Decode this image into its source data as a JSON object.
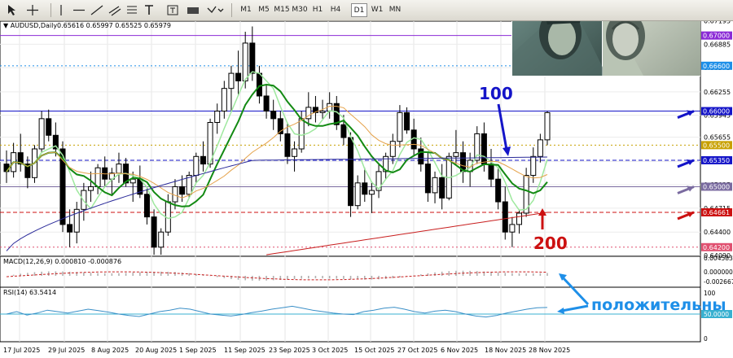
{
  "toolbar": {
    "timeframes": [
      "M1",
      "M5",
      "M15",
      "M30",
      "H1",
      "H4",
      "D1",
      "W1",
      "MN"
    ],
    "active_timeframe": "D1",
    "tools": [
      "cursor-icon",
      "crosshair-icon",
      "vertical-line-icon",
      "horizontal-line-icon",
      "trendline-icon",
      "channel-icon",
      "fibonacci-icon",
      "text-icon",
      "label-icon",
      "rectangle-icon",
      "shapes-icon"
    ]
  },
  "chart_data": {
    "type": "candlestick",
    "symbol_label": "AUDUSD,Daily",
    "ohlc_label": "0.65616 0.65997 0.65525 0.65979",
    "y_range": [
      0.6409,
      0.6719
    ],
    "y_ticks": [
      "0.67195",
      "0.66885",
      "0.66575",
      "0.66255",
      "0.65945",
      "0.65655",
      "0.65335",
      "0.65025",
      "0.64715",
      "0.64400",
      "0.64090"
    ],
    "x_labels": [
      "17 Jul 2025",
      "29 Jul 2025",
      "8 Aug 2025",
      "20 Aug 2025",
      "1 Sep 2025",
      "11 Sep 2025",
      "23 Sep 2025",
      "3 Oct 2025",
      "15 Oct 2025",
      "27 Oct 2025",
      "6 Nov 2025",
      "18 Nov 2025",
      "28 Nov 2025"
    ],
    "levels": [
      {
        "price": 0.67,
        "label": "0.67000",
        "color": "#8b2bd6",
        "style": "solid"
      },
      {
        "price": 0.666,
        "label": "0.66600",
        "color": "#1e8fe8",
        "style": "dotted"
      },
      {
        "price": 0.66,
        "label": "0.66000",
        "color": "#1414c8",
        "style": "solid"
      },
      {
        "price": 0.6555,
        "label": "0.65500",
        "color": "#c8a000",
        "style": "dotted"
      },
      {
        "price": 0.6535,
        "label": "0.65350",
        "color": "#1414c8",
        "style": "dashed"
      },
      {
        "price": 0.65,
        "label": "0.65000",
        "color": "#7a6ba0",
        "style": "solid"
      },
      {
        "price": 0.64661,
        "label": "0.64661",
        "color": "#cc1010",
        "style": "dashed"
      },
      {
        "price": 0.642,
        "label": "0.64200",
        "color": "#e05070",
        "style": "dotted"
      }
    ],
    "arrow_colors": [
      "#8b2bd6",
      "#1e8fe8",
      "#1414c8",
      "#1414c8",
      "#7a6ba0",
      "#cc1010"
    ],
    "annotations": {
      "ma100": "100",
      "ma200": "200",
      "rsi_text": "положительны"
    },
    "ohlc": [
      [
        0.653,
        0.6548,
        0.6505,
        0.652
      ],
      [
        0.652,
        0.6558,
        0.6512,
        0.6545
      ],
      [
        0.6545,
        0.657,
        0.652,
        0.653
      ],
      [
        0.653,
        0.654,
        0.6498,
        0.6512
      ],
      [
        0.6512,
        0.6555,
        0.6505,
        0.655
      ],
      [
        0.655,
        0.66,
        0.6545,
        0.659
      ],
      [
        0.659,
        0.6602,
        0.656,
        0.6568
      ],
      [
        0.6568,
        0.6585,
        0.654,
        0.655
      ],
      [
        0.655,
        0.656,
        0.644,
        0.645
      ],
      [
        0.645,
        0.647,
        0.642,
        0.644
      ],
      [
        0.644,
        0.648,
        0.6425,
        0.647
      ],
      [
        0.647,
        0.6505,
        0.6455,
        0.6495
      ],
      [
        0.6495,
        0.652,
        0.648,
        0.65
      ],
      [
        0.65,
        0.653,
        0.649,
        0.6525
      ],
      [
        0.6525,
        0.654,
        0.65,
        0.651
      ],
      [
        0.651,
        0.6525,
        0.649,
        0.6518
      ],
      [
        0.6518,
        0.6545,
        0.6505,
        0.653
      ],
      [
        0.653,
        0.6538,
        0.65,
        0.6505
      ],
      [
        0.6505,
        0.652,
        0.648,
        0.651
      ],
      [
        0.651,
        0.6528,
        0.6485,
        0.649
      ],
      [
        0.649,
        0.65,
        0.645,
        0.646
      ],
      [
        0.646,
        0.647,
        0.641,
        0.642
      ],
      [
        0.642,
        0.6445,
        0.641,
        0.644
      ],
      [
        0.644,
        0.649,
        0.6435,
        0.648
      ],
      [
        0.648,
        0.651,
        0.647,
        0.65
      ],
      [
        0.65,
        0.6515,
        0.648,
        0.649
      ],
      [
        0.649,
        0.652,
        0.6485,
        0.6515
      ],
      [
        0.6515,
        0.6545,
        0.6505,
        0.654
      ],
      [
        0.654,
        0.656,
        0.652,
        0.653
      ],
      [
        0.653,
        0.659,
        0.6525,
        0.6585
      ],
      [
        0.6585,
        0.661,
        0.657,
        0.66
      ],
      [
        0.66,
        0.664,
        0.659,
        0.663
      ],
      [
        0.663,
        0.666,
        0.66,
        0.665
      ],
      [
        0.665,
        0.668,
        0.662,
        0.664
      ],
      [
        0.664,
        0.6705,
        0.663,
        0.669
      ],
      [
        0.669,
        0.6712,
        0.664,
        0.665
      ],
      [
        0.665,
        0.666,
        0.661,
        0.662
      ],
      [
        0.662,
        0.6635,
        0.659,
        0.66
      ],
      [
        0.66,
        0.6615,
        0.6575,
        0.659
      ],
      [
        0.659,
        0.66,
        0.656,
        0.657
      ],
      [
        0.657,
        0.6585,
        0.653,
        0.654
      ],
      [
        0.654,
        0.656,
        0.652,
        0.655
      ],
      [
        0.655,
        0.66,
        0.6545,
        0.659
      ],
      [
        0.659,
        0.6625,
        0.658,
        0.6605
      ],
      [
        0.6605,
        0.662,
        0.6585,
        0.6598
      ],
      [
        0.6598,
        0.6615,
        0.659,
        0.66
      ],
      [
        0.66,
        0.6625,
        0.659,
        0.661
      ],
      [
        0.661,
        0.662,
        0.6575,
        0.6582
      ],
      [
        0.6582,
        0.6595,
        0.6555,
        0.6565
      ],
      [
        0.6565,
        0.6572,
        0.646,
        0.6475
      ],
      [
        0.6475,
        0.6515,
        0.647,
        0.6505
      ],
      [
        0.6505,
        0.6525,
        0.648,
        0.649
      ],
      [
        0.649,
        0.6505,
        0.6465,
        0.6495
      ],
      [
        0.6495,
        0.653,
        0.6485,
        0.652
      ],
      [
        0.652,
        0.6545,
        0.651,
        0.654
      ],
      [
        0.654,
        0.657,
        0.653,
        0.656
      ],
      [
        0.656,
        0.6608,
        0.6552,
        0.6598
      ],
      [
        0.6598,
        0.6605,
        0.657,
        0.6575
      ],
      [
        0.6575,
        0.659,
        0.654,
        0.655
      ],
      [
        0.655,
        0.6565,
        0.652,
        0.653
      ],
      [
        0.653,
        0.6545,
        0.648,
        0.6492
      ],
      [
        0.6492,
        0.652,
        0.6478,
        0.6512
      ],
      [
        0.6512,
        0.653,
        0.647,
        0.6485
      ],
      [
        0.6485,
        0.6545,
        0.6482,
        0.654
      ],
      [
        0.654,
        0.6575,
        0.653,
        0.6545
      ],
      [
        0.6545,
        0.656,
        0.6505,
        0.652
      ],
      [
        0.652,
        0.6545,
        0.65,
        0.6535
      ],
      [
        0.6535,
        0.658,
        0.653,
        0.657
      ],
      [
        0.657,
        0.6585,
        0.652,
        0.653
      ],
      [
        0.653,
        0.655,
        0.65,
        0.651
      ],
      [
        0.651,
        0.6525,
        0.647,
        0.648
      ],
      [
        0.648,
        0.65,
        0.643,
        0.644
      ],
      [
        0.644,
        0.646,
        0.642,
        0.645
      ],
      [
        0.645,
        0.647,
        0.6438,
        0.6465
      ],
      [
        0.6465,
        0.6525,
        0.646,
        0.6515
      ],
      [
        0.6515,
        0.6552,
        0.6505,
        0.654
      ],
      [
        0.654,
        0.657,
        0.6532,
        0.6562
      ],
      [
        0.6562,
        0.66,
        0.6555,
        0.6598
      ]
    ],
    "ma_fast_green": [
      0.654,
      0.6536,
      0.6532,
      0.6528,
      0.6522,
      0.6515,
      0.6506,
      0.6498,
      0.6492,
      0.649,
      0.6492,
      0.6496,
      0.65,
      0.6505,
      0.651,
      0.6515,
      0.652,
      0.6526,
      0.6533,
      0.654,
      0.6545,
      0.6548,
      0.6552,
      0.6558,
      0.6566,
      0.6575,
      0.658,
      0.6582,
      0.658,
      0.6575,
      0.6568,
      0.656,
      0.655,
      0.654,
      0.653,
      0.6522,
      0.6515,
      0.6508,
      0.6505,
      0.6503,
      0.6503,
      0.6505,
      0.6508,
      0.6512,
      0.6516,
      0.652,
      0.6525,
      0.653,
      0.6535,
      0.654
    ],
    "rsi": [
      0.5,
      0.55,
      0.48,
      0.52,
      0.58,
      0.55,
      0.52,
      0.56,
      0.6,
      0.57,
      0.54,
      0.5,
      0.47,
      0.45,
      0.5,
      0.55,
      0.58,
      0.62,
      0.6,
      0.55,
      0.5,
      0.48,
      0.46,
      0.49,
      0.53,
      0.56,
      0.6,
      0.63,
      0.66,
      0.62,
      0.58,
      0.55,
      0.52,
      0.5,
      0.49,
      0.55,
      0.58,
      0.62,
      0.64,
      0.6,
      0.55,
      0.52,
      0.56,
      0.58,
      0.55,
      0.5,
      0.46,
      0.44,
      0.47,
      0.52,
      0.56,
      0.6,
      0.63,
      0.6354
    ],
    "macd_label": "MACD(12,26,9) 0.000810 -0.000876",
    "macd_ticks": [
      "0.004583",
      "0.000000",
      "-0.002667"
    ],
    "rsi_label": "RSI(14) 63.5414",
    "rsi_ticks": [
      "100",
      "50.0000",
      "0"
    ],
    "rsi_level": 50
  }
}
